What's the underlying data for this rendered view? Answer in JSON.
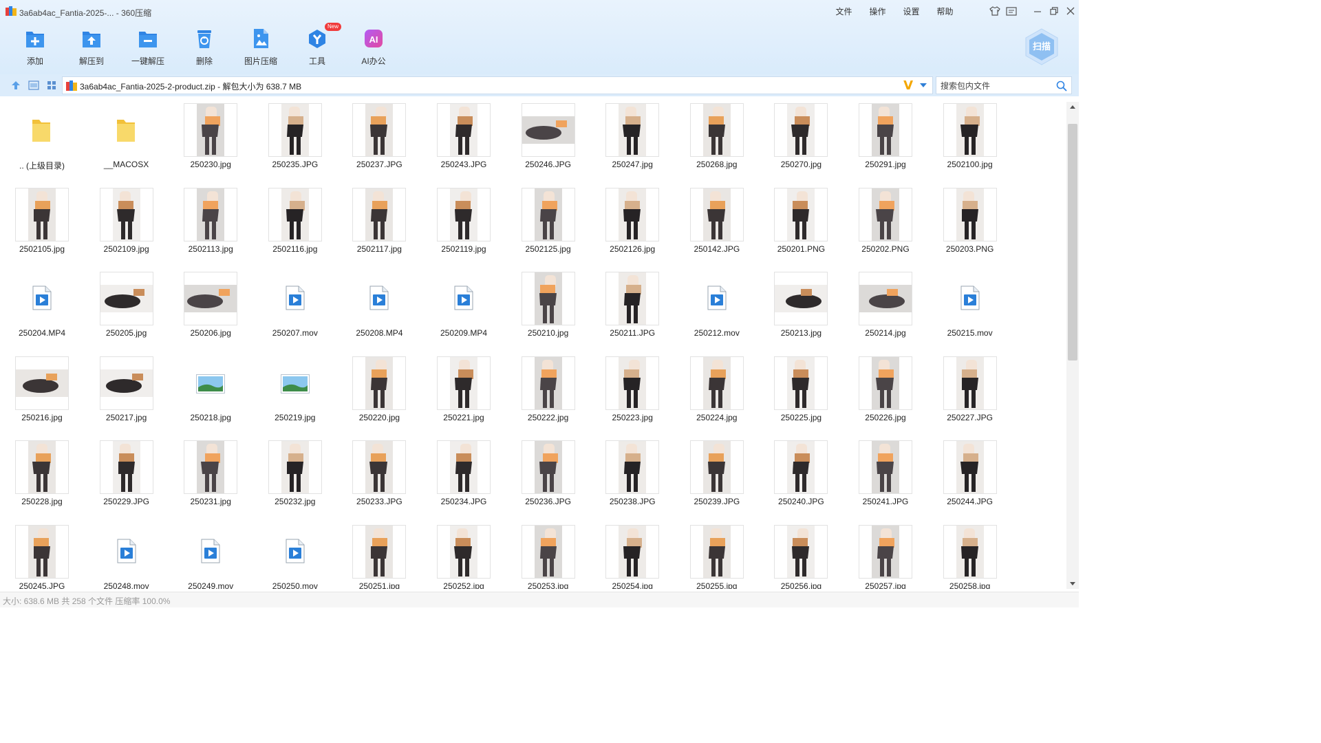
{
  "window": {
    "title": "3a6ab4ac_Fantia-2025-... - 360压缩",
    "menu": [
      "文件",
      "操作",
      "设置",
      "帮助"
    ]
  },
  "toolbar": {
    "buttons": [
      {
        "label": "添加",
        "icon": "add-icon"
      },
      {
        "label": "解压到",
        "icon": "extract-to-icon"
      },
      {
        "label": "一键解压",
        "icon": "one-click-extract-icon"
      },
      {
        "label": "删除",
        "icon": "delete-icon"
      },
      {
        "label": "图片压缩",
        "icon": "image-compress-icon"
      },
      {
        "label": "工具",
        "icon": "tools-icon",
        "badge": "New"
      },
      {
        "label": "AI办公",
        "icon": "ai-office-icon"
      }
    ],
    "scan_label": "扫描"
  },
  "address": {
    "path": "3a6ab4ac_Fantia-2025-2-product.zip - 解包大小为 638.7 MB",
    "search_placeholder": "搜索包内文件"
  },
  "files": [
    {
      "name": ".. (上级目录)",
      "type": "folder"
    },
    {
      "name": "__MACOSX",
      "type": "folder"
    },
    {
      "name": "250230.jpg",
      "type": "photo",
      "orient": "portrait"
    },
    {
      "name": "250235.JPG",
      "type": "photo",
      "orient": "portrait"
    },
    {
      "name": "250237.JPG",
      "type": "photo",
      "orient": "portrait"
    },
    {
      "name": "250243.JPG",
      "type": "photo",
      "orient": "portrait"
    },
    {
      "name": "250246.JPG",
      "type": "photo",
      "orient": "landscape"
    },
    {
      "name": "250247.jpg",
      "type": "photo",
      "orient": "portrait"
    },
    {
      "name": "250268.jpg",
      "type": "photo",
      "orient": "portrait"
    },
    {
      "name": "250270.jpg",
      "type": "photo",
      "orient": "portrait"
    },
    {
      "name": "250291.jpg",
      "type": "photo",
      "orient": "portrait"
    },
    {
      "name": "2502100.jpg",
      "type": "photo",
      "orient": "portrait"
    },
    {
      "name": "2502105.jpg",
      "type": "photo",
      "orient": "portrait"
    },
    {
      "name": "2502109.jpg",
      "type": "photo",
      "orient": "portrait"
    },
    {
      "name": "2502113.jpg",
      "type": "photo",
      "orient": "portrait"
    },
    {
      "name": "2502116.jpg",
      "type": "photo",
      "orient": "portrait"
    },
    {
      "name": "2502117.jpg",
      "type": "photo",
      "orient": "portrait"
    },
    {
      "name": "2502119.jpg",
      "type": "photo",
      "orient": "portrait"
    },
    {
      "name": "2502125.jpg",
      "type": "photo",
      "orient": "portrait"
    },
    {
      "name": "2502126.jpg",
      "type": "photo",
      "orient": "portrait"
    },
    {
      "name": "250142.JPG",
      "type": "photo",
      "orient": "portrait"
    },
    {
      "name": "250201.PNG",
      "type": "photo",
      "orient": "portrait"
    },
    {
      "name": "250202.PNG",
      "type": "photo",
      "orient": "portrait"
    },
    {
      "name": "250203.PNG",
      "type": "photo",
      "orient": "portrait"
    },
    {
      "name": "250204.MP4",
      "type": "video"
    },
    {
      "name": "250205.jpg",
      "type": "photo",
      "orient": "landscape"
    },
    {
      "name": "250206.jpg",
      "type": "photo",
      "orient": "landscape"
    },
    {
      "name": "250207.mov",
      "type": "video"
    },
    {
      "name": "250208.MP4",
      "type": "video"
    },
    {
      "name": "250209.MP4",
      "type": "video"
    },
    {
      "name": "250210.jpg",
      "type": "photo",
      "orient": "portrait"
    },
    {
      "name": "250211.JPG",
      "type": "photo",
      "orient": "portrait"
    },
    {
      "name": "250212.mov",
      "type": "video"
    },
    {
      "name": "250213.jpg",
      "type": "photo",
      "orient": "landscape"
    },
    {
      "name": "250214.jpg",
      "type": "photo",
      "orient": "landscape"
    },
    {
      "name": "250215.mov",
      "type": "video"
    },
    {
      "name": "250216.jpg",
      "type": "photo",
      "orient": "landscape"
    },
    {
      "name": "250217.jpg",
      "type": "photo",
      "orient": "landscape"
    },
    {
      "name": "250218.jpg",
      "type": "image"
    },
    {
      "name": "250219.jpg",
      "type": "image"
    },
    {
      "name": "250220.jpg",
      "type": "photo",
      "orient": "portrait"
    },
    {
      "name": "250221.jpg",
      "type": "photo",
      "orient": "portrait"
    },
    {
      "name": "250222.jpg",
      "type": "photo",
      "orient": "portrait"
    },
    {
      "name": "250223.jpg",
      "type": "photo",
      "orient": "portrait"
    },
    {
      "name": "250224.jpg",
      "type": "photo",
      "orient": "portrait"
    },
    {
      "name": "250225.jpg",
      "type": "photo",
      "orient": "portrait"
    },
    {
      "name": "250226.jpg",
      "type": "photo",
      "orient": "portrait"
    },
    {
      "name": "250227.JPG",
      "type": "photo",
      "orient": "portrait"
    },
    {
      "name": "250228.jpg",
      "type": "photo",
      "orient": "portrait"
    },
    {
      "name": "250229.JPG",
      "type": "photo",
      "orient": "portrait"
    },
    {
      "name": "250231.jpg",
      "type": "photo",
      "orient": "portrait"
    },
    {
      "name": "250232.jpg",
      "type": "photo",
      "orient": "portrait"
    },
    {
      "name": "250233.JPG",
      "type": "photo",
      "orient": "portrait"
    },
    {
      "name": "250234.JPG",
      "type": "photo",
      "orient": "portrait"
    },
    {
      "name": "250236.JPG",
      "type": "photo",
      "orient": "portrait"
    },
    {
      "name": "250238.JPG",
      "type": "photo",
      "orient": "portrait"
    },
    {
      "name": "250239.JPG",
      "type": "photo",
      "orient": "portrait"
    },
    {
      "name": "250240.JPG",
      "type": "photo",
      "orient": "portrait"
    },
    {
      "name": "250241.JPG",
      "type": "photo",
      "orient": "portrait"
    },
    {
      "name": "250244.JPG",
      "type": "photo",
      "orient": "portrait"
    },
    {
      "name": "250245.JPG",
      "type": "photo",
      "orient": "portrait"
    },
    {
      "name": "250248.mov",
      "type": "video"
    },
    {
      "name": "250249.mov",
      "type": "video"
    },
    {
      "name": "250250.mov",
      "type": "video"
    },
    {
      "name": "250251.jpg",
      "type": "photo",
      "orient": "portrait"
    },
    {
      "name": "250252.jpg",
      "type": "photo",
      "orient": "portrait"
    },
    {
      "name": "250253.jpg",
      "type": "photo",
      "orient": "portrait"
    },
    {
      "name": "250254.jpg",
      "type": "photo",
      "orient": "portrait"
    },
    {
      "name": "250255.jpg",
      "type": "photo",
      "orient": "portrait"
    },
    {
      "name": "250256.jpg",
      "type": "photo",
      "orient": "portrait"
    },
    {
      "name": "250257.jpg",
      "type": "photo",
      "orient": "portrait"
    },
    {
      "name": "250258.jpg",
      "type": "photo",
      "orient": "portrait"
    }
  ],
  "status": {
    "text": "大小: 638.6 MB 共 258 个文件 压缩率 100.0%"
  },
  "colors": {
    "accent": "#2f84e4",
    "header_bg": "#e4f0fc",
    "badge": "#f03b3b",
    "folder": "#f5c842"
  }
}
